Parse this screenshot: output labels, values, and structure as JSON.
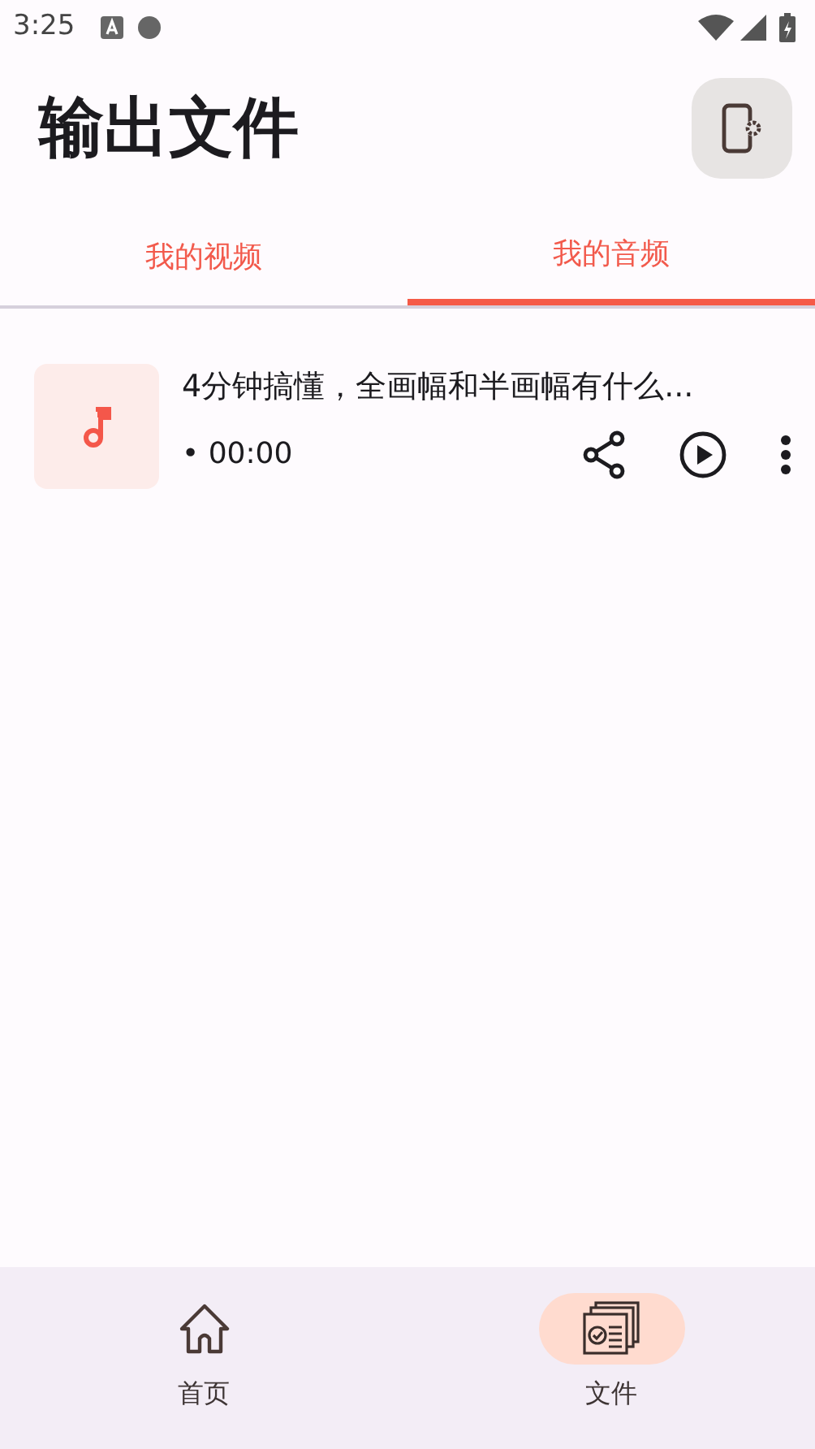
{
  "status_bar": {
    "time": "3:25"
  },
  "header": {
    "title": "输出文件"
  },
  "tabs": [
    {
      "label": "我的视频",
      "selected": false
    },
    {
      "label": "我的音频",
      "selected": true
    }
  ],
  "files": [
    {
      "title": "4分钟搞懂，全画幅和半画幅有什么...",
      "duration": "• 00:00"
    }
  ],
  "bottom_nav": [
    {
      "label": "首页",
      "kind": "home",
      "selected": false
    },
    {
      "label": "文件",
      "kind": "files",
      "selected": true
    }
  ]
}
